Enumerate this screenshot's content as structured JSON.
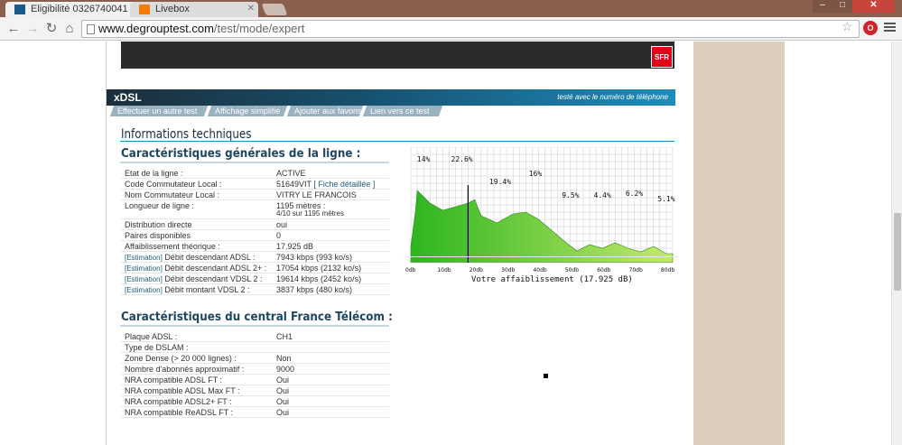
{
  "browser": {
    "tabs": [
      {
        "title": "Eligibilité 0326740041 - …"
      },
      {
        "title": "Livebox"
      }
    ],
    "url": {
      "host": "www.degrouptest.com",
      "path": "/test/mode/expert"
    }
  },
  "header": {
    "sfr_logo": "SFR",
    "section_title": "xDSL",
    "section_note": "testé avec le numéro de téléphone",
    "nav": [
      "Effectuer un autre test",
      "Affichage simplifié",
      "Ajouter aux favoris",
      "Lien vers ce test"
    ]
  },
  "info_title": "Informations techniques",
  "line": {
    "title": "Caractéristiques générales de la ligne :",
    "estimation_tag": "[Estimation]",
    "rows": [
      {
        "label": "Etat de la ligne :",
        "value": "ACTIVE"
      },
      {
        "label": "Code Commutateur Local :",
        "value": "51649VIT",
        "link": "[ Fiche détaillée ]"
      },
      {
        "label": "Nom Commutateur Local :",
        "value": "VITRY LE FRANCOIS"
      },
      {
        "label": "Longueur de ligne :",
        "value": "1195 mètres :",
        "value2": "4/10 sur 1195 mètres"
      },
      {
        "label": "Distribution directe",
        "value": "oui"
      },
      {
        "label": "Paires disponibles",
        "value": "0"
      },
      {
        "label": "Affaiblissement théorique :",
        "value": "17.925 dB"
      },
      {
        "label": "Débit descendant ADSL :",
        "value": "7943 kbps (993 ko/s)",
        "estimated": true
      },
      {
        "label": "Débit descendant ADSL 2+ :",
        "value": "17054 kbps (2132 ko/s)",
        "estimated": true
      },
      {
        "label": "Débit descendant VDSL 2 :",
        "value": "19614 kbps (2452 ko/s)",
        "estimated": true
      },
      {
        "label": "Débit montant VDSL 2 :",
        "value": "3837 kbps (480 ko/s)",
        "estimated": true
      }
    ]
  },
  "central": {
    "title": "Caractéristiques du central France Télécom :",
    "rows": [
      {
        "label": "Plaque ADSL :",
        "value": "CH1"
      },
      {
        "label": "Type de DSLAM :",
        "value": ""
      },
      {
        "label": "Zone Dense (> 20 000 lignes) :",
        "value": "Non"
      },
      {
        "label": "Nombre d'abonnés approximatif :",
        "value": "9000"
      },
      {
        "label": "NRA compatible ADSL FT :",
        "value": "Oui"
      },
      {
        "label": "NRA compatible ADSL Max FT :",
        "value": "Oui"
      },
      {
        "label": "NRA compatible ADSL2+ FT :",
        "value": "Oui"
      },
      {
        "label": "NRA compatible ReADSL FT :",
        "value": "Oui"
      }
    ]
  },
  "chart": {
    "caption": "Votre affaiblissement (17.925 dB)",
    "x_ticks": [
      "0db",
      "10db",
      "20db",
      "30db",
      "40db",
      "50db",
      "60db",
      "70db",
      "80db"
    ],
    "bins": [
      "14%",
      "22.6%",
      "19.4%",
      "16%",
      "9.5%",
      "4.4%",
      "6.2%",
      "5.1%"
    ],
    "marker_db": 17.925,
    "colors": {
      "fill_dark": "#2db51f",
      "fill_light": "#c5e96a",
      "grid": "#cccccc"
    }
  }
}
